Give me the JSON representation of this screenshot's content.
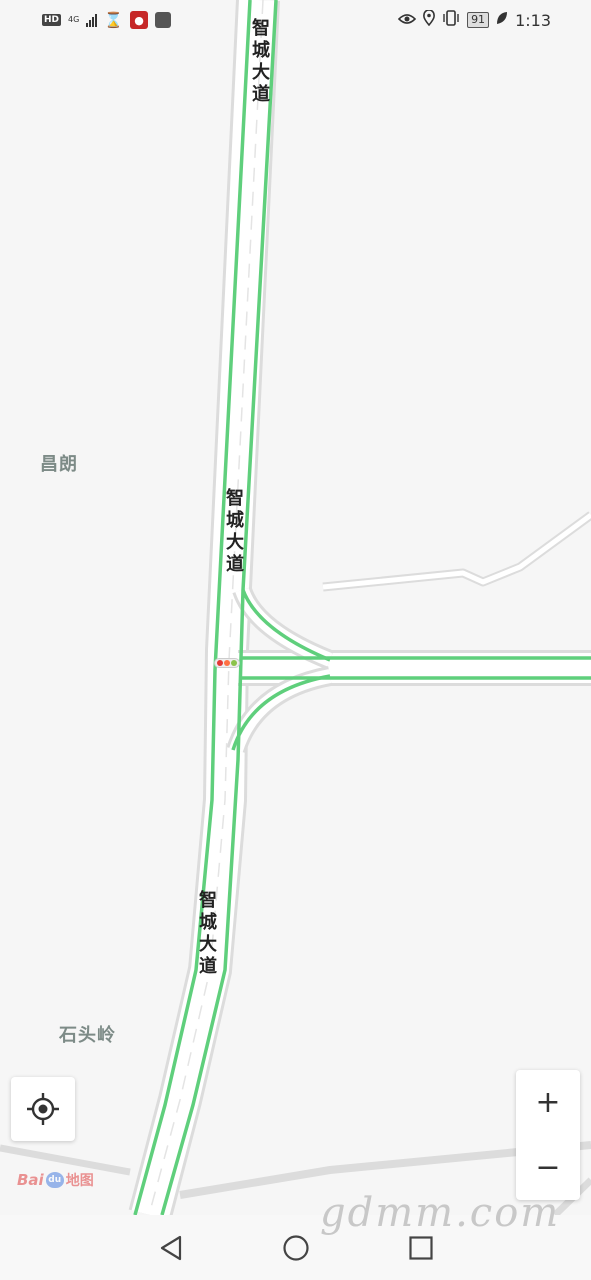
{
  "status_bar": {
    "hd": "HD",
    "network": "4G",
    "time": "1:13",
    "battery": "91",
    "icons": [
      "hourglass-icon",
      "mic-icon",
      "app-icon",
      "eye-icon",
      "location-icon",
      "vibrate-icon",
      "leaf-icon"
    ]
  },
  "map": {
    "road_name": "智城大道",
    "places": {
      "changlang": "昌朗",
      "shitouling": "石头岭"
    },
    "traffic_light_colors": [
      "#e53935",
      "#ff7043",
      "#8bc34a"
    ],
    "road_color": "#5fcf7c"
  },
  "controls": {
    "zoom_in": "+",
    "zoom_out": "−"
  },
  "logo": {
    "bai": "Bai",
    "du": "du",
    "cn": "地图"
  },
  "watermark": "gdmm.com",
  "nav": {
    "icons": [
      "back-icon",
      "home-icon",
      "recents-icon"
    ]
  }
}
